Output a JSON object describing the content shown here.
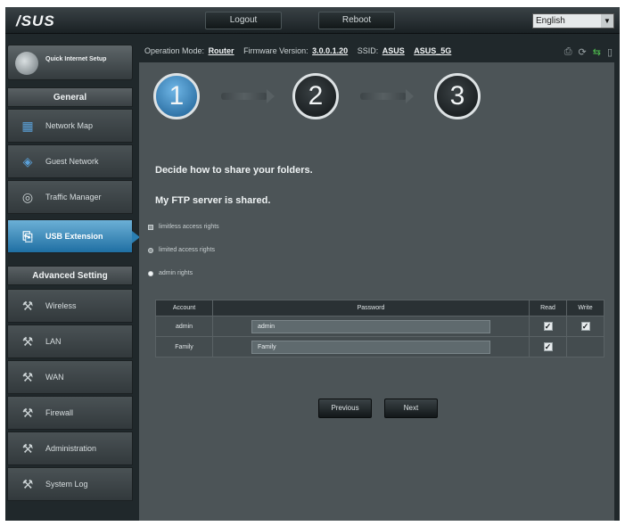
{
  "header": {
    "logo": "/SUS",
    "logout_label": "Logout",
    "reboot_label": "Reboot",
    "language_value": "English"
  },
  "infobar": {
    "op_mode_label": "Operation Mode:",
    "op_mode_value": "Router",
    "firmware_label": "Firmware Version:",
    "firmware_value": "3.0.0.1.20",
    "ssid_label": "SSID:",
    "ssid_1": "ASUS",
    "ssid_2": "ASUS_5G"
  },
  "sidebar": {
    "qis_label": "Quick Internet Setup",
    "general_header": "General",
    "general_items": [
      {
        "label": "Network Map",
        "icon": "network-map-icon"
      },
      {
        "label": "Guest Network",
        "icon": "guest-network-icon"
      },
      {
        "label": "Traffic Manager",
        "icon": "traffic-manager-icon"
      },
      {
        "label": "USB Extension",
        "icon": "usb-extension-icon"
      }
    ],
    "advanced_header": "Advanced Setting",
    "advanced_items": [
      {
        "label": "Wireless"
      },
      {
        "label": "LAN"
      },
      {
        "label": "WAN"
      },
      {
        "label": "Firewall"
      },
      {
        "label": "Administration"
      },
      {
        "label": "System Log"
      }
    ]
  },
  "wizard": {
    "steps": [
      "1",
      "2",
      "3"
    ],
    "active_step": 1,
    "heading": "Decide how to share your folders.",
    "subheading": "My FTP server is shared.",
    "options": [
      {
        "label": "limitless access rights",
        "selected": false
      },
      {
        "label": "limited access rights",
        "selected": false
      },
      {
        "label": "admin rights",
        "selected": true
      }
    ]
  },
  "accounts_table": {
    "columns": [
      "Account",
      "Password",
      "Read",
      "Write"
    ],
    "rows": [
      {
        "account": "admin",
        "password": "admin",
        "read": true,
        "write": true
      },
      {
        "account": "Family",
        "password": "Family",
        "read": true,
        "write": false
      }
    ]
  },
  "buttons": {
    "previous": "Previous",
    "next": "Next"
  },
  "colors": {
    "accent": "#2a7fb3",
    "panel": "#4c5457",
    "frame": "#20282b"
  }
}
